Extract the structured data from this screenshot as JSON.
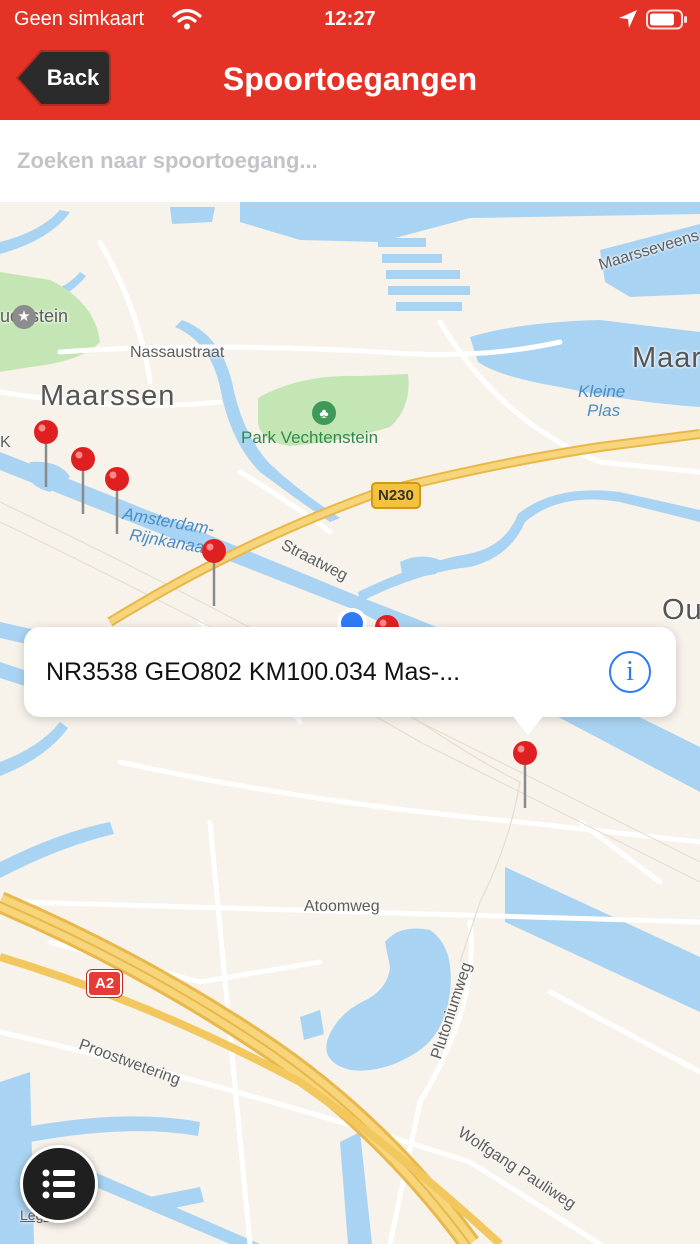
{
  "status_bar": {
    "carrier": "Geen simkaart",
    "time": "12:27",
    "icons": [
      "wifi-icon",
      "location-arrow-icon",
      "battery-icon"
    ]
  },
  "nav": {
    "back_label": "Back",
    "title": "Spoortoegangen"
  },
  "search": {
    "placeholder": "Zoeken naar spoortoegang...",
    "value": ""
  },
  "map": {
    "labels": {
      "town_maarssen": "Maarssen",
      "town_maar": "Maar",
      "town_ou": "Ou",
      "area_udestein": "udestein",
      "street_nassaustraat": "Nassaustraat",
      "street_straatweg": "Straatweg",
      "street_atoomweg": "Atoomweg",
      "street_plutoniumweg": "Plutoniumweg",
      "street_proostwetering": "Proostwetering",
      "street_wolfgang_pauliweg": "Wolfgang Pauliweg",
      "street_maarsseveens": "Maarsseveens",
      "water_amsterdam_line1": "Amsterdam-",
      "water_amsterdam_line2": "Rijnkanaal",
      "water_kleine_line1": "Kleine",
      "water_kleine_line2": "Plas",
      "park_vechtenstein": "Park Vechtenstein",
      "edge_k": "K",
      "legal": "Legal"
    },
    "road_shields": {
      "n230": "N230",
      "a2": "A2"
    },
    "colors": {
      "land": "#f7f2ea",
      "water": "#a9d3f2",
      "park": "#c4e6b4",
      "highway": "#f4c860",
      "pin": "#e02020",
      "user_location": "#2f7bf6"
    }
  },
  "callout": {
    "title": "NR3538 GEO802 KM100.034 Mas-...",
    "info_icon": "info-circle-icon"
  },
  "list_button": {
    "icon": "list-icon"
  }
}
